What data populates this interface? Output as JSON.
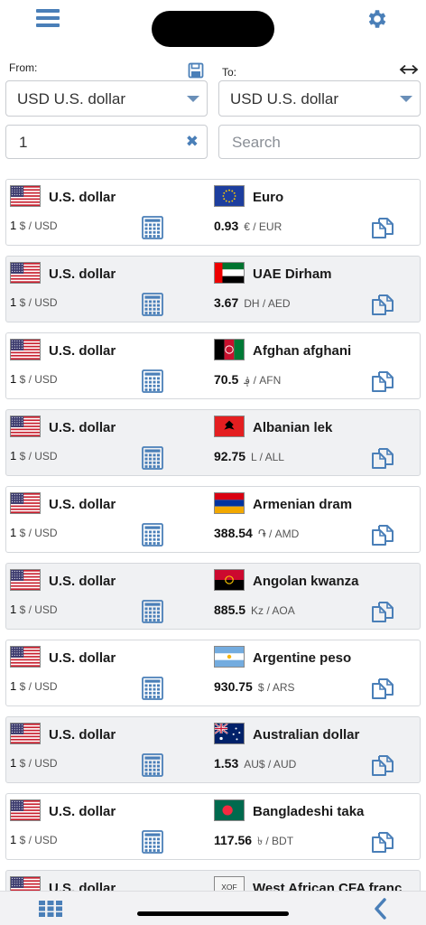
{
  "header": {
    "menu_icon": "hamburger-menu-icon",
    "settings_icon": "gear-icon"
  },
  "converter": {
    "from_label": "From:",
    "to_label": "To:",
    "from_currency": "USD U.S. dollar",
    "to_currency": "USD U.S. dollar",
    "amount": "1",
    "search_placeholder": "Search"
  },
  "colors": {
    "accent": "#4a7fb8",
    "row_alt": "#f0f1f3",
    "border": "#c9ccd1"
  },
  "rows": [
    {
      "from_name": "U.S. dollar",
      "from_num": "1",
      "from_unit": "$ / USD",
      "to_name": "Euro",
      "to_num": "0.93",
      "to_unit": "€ / EUR",
      "flag": "eu"
    },
    {
      "from_name": "U.S. dollar",
      "from_num": "1",
      "from_unit": "$ / USD",
      "to_name": "UAE Dirham",
      "to_num": "3.67",
      "to_unit": "DH / AED",
      "flag": "ae"
    },
    {
      "from_name": "U.S. dollar",
      "from_num": "1",
      "from_unit": "$ / USD",
      "to_name": "Afghan afghani",
      "to_num": "70.5",
      "to_unit": "؋ / AFN",
      "flag": "af"
    },
    {
      "from_name": "U.S. dollar",
      "from_num": "1",
      "from_unit": "$ / USD",
      "to_name": "Albanian lek",
      "to_num": "92.75",
      "to_unit": "L / ALL",
      "flag": "al"
    },
    {
      "from_name": "U.S. dollar",
      "from_num": "1",
      "from_unit": "$ / USD",
      "to_name": "Armenian dram",
      "to_num": "388.54",
      "to_unit": "֏ / AMD",
      "flag": "am"
    },
    {
      "from_name": "U.S. dollar",
      "from_num": "1",
      "from_unit": "$ / USD",
      "to_name": "Angolan kwanza",
      "to_num": "885.5",
      "to_unit": "Kz / AOA",
      "flag": "ao"
    },
    {
      "from_name": "U.S. dollar",
      "from_num": "1",
      "from_unit": "$ / USD",
      "to_name": "Argentine peso",
      "to_num": "930.75",
      "to_unit": "$ / ARS",
      "flag": "ar"
    },
    {
      "from_name": "U.S. dollar",
      "from_num": "1",
      "from_unit": "$ / USD",
      "to_name": "Australian dollar",
      "to_num": "1.53",
      "to_unit": "AU$ / AUD",
      "flag": "au"
    },
    {
      "from_name": "U.S. dollar",
      "from_num": "1",
      "from_unit": "$ / USD",
      "to_name": "Bangladeshi taka",
      "to_num": "117.56",
      "to_unit": "৳ / BDT",
      "flag": "bd"
    },
    {
      "from_name": "U.S. dollar",
      "from_num": "",
      "from_unit": "",
      "to_name": "West African CFA franc",
      "to_num": "",
      "to_unit": "",
      "flag": "xof",
      "flag_text": "XOF"
    }
  ],
  "footer": {
    "grid_icon": "grid-icon",
    "back_icon": "chevron-left-icon"
  }
}
